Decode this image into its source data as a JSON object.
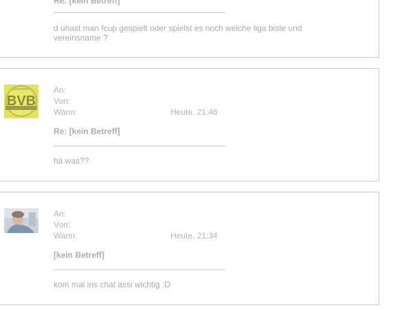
{
  "messages": [
    {
      "subject": "Re: [kein Betreff]",
      "body": "d uhast man fcup gespielt oder spielst es noch welche liga biste und vereinsname ?"
    },
    {
      "labels": {
        "to": "An:",
        "from": "Von:",
        "when": "Wann:"
      },
      "time": "Heute, 21:46",
      "subject": "Re: [kein Betreff]",
      "body": "hä was??",
      "avatar": "bvb-logo-avatar"
    },
    {
      "labels": {
        "to": "An:",
        "from": "Von:",
        "when": "Wann:"
      },
      "time": "Heute, 21:34",
      "subject": "[kein Betreff]",
      "body": "kom mal ins chat assi wichtig :D",
      "avatar": "user-photo-avatar"
    }
  ],
  "colors": {
    "text": "#b3b3b3",
    "border": "#c8c8c8",
    "logo_yellow": "#e6e64a"
  }
}
